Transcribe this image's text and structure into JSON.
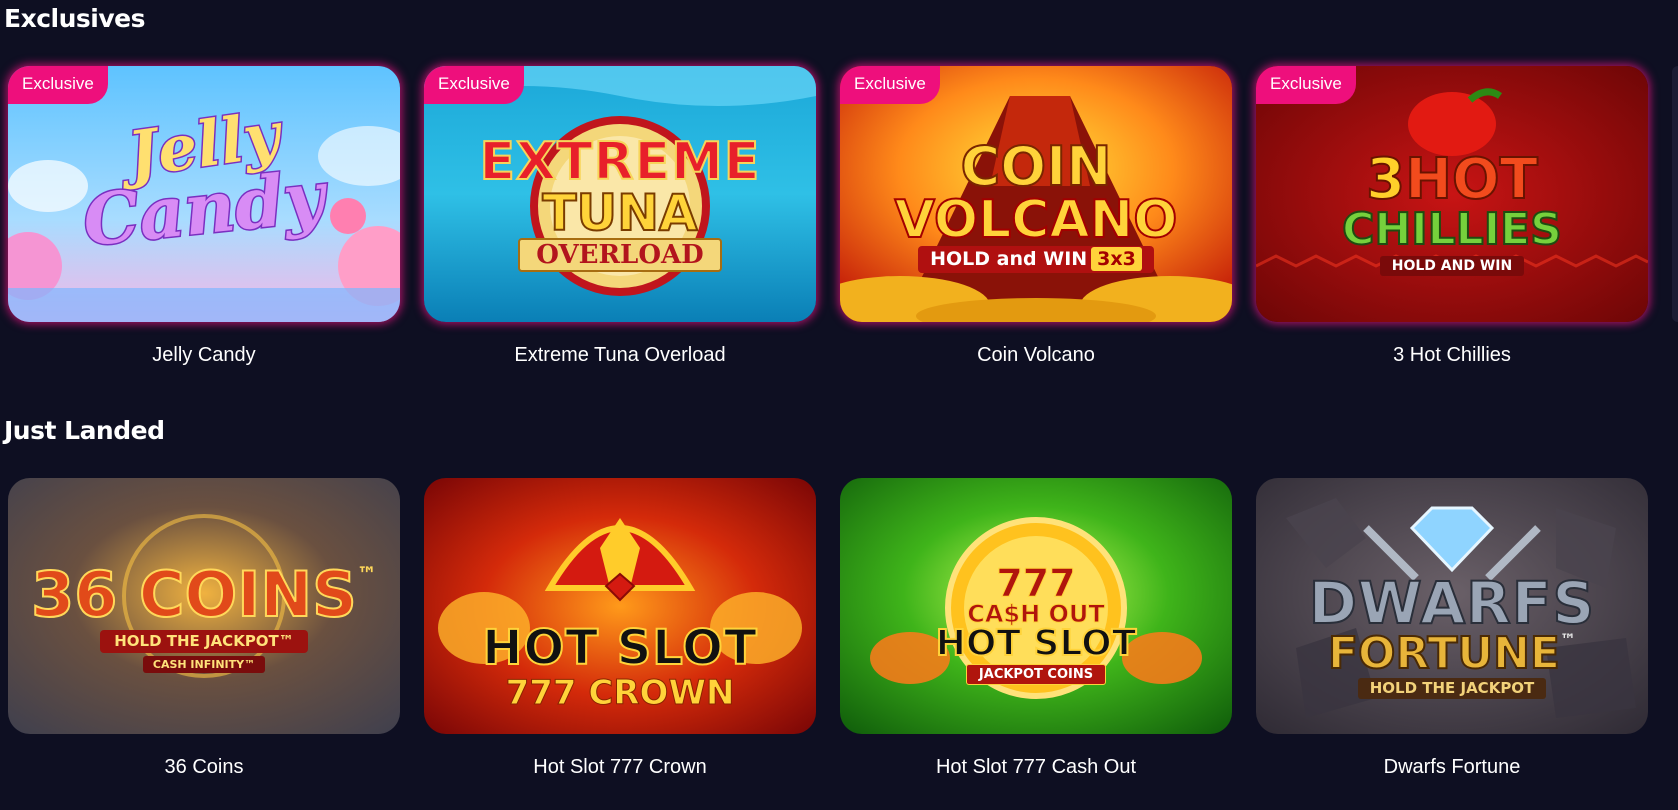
{
  "sections": [
    {
      "title": "Exclusives",
      "games": [
        {
          "name": "Jelly Candy",
          "badge": "Exclusive",
          "logo": [
            "Jelly",
            "Candy"
          ]
        },
        {
          "name": "Extreme Tuna Overload",
          "badge": "Exclusive",
          "logo": [
            "EXTREME",
            "TUNA",
            "OVERLOAD"
          ]
        },
        {
          "name": "Coin Volcano",
          "badge": "Exclusive",
          "logo": [
            "COIN",
            "VOLCANO",
            "HOLD and WIN",
            "3x3"
          ]
        },
        {
          "name": "3 Hot Chillies",
          "badge": "Exclusive",
          "logo": [
            "3",
            "HOT",
            "CHILLIES",
            "HOLD AND WIN"
          ]
        }
      ]
    },
    {
      "title": "Just Landed",
      "games": [
        {
          "name": "36 Coins",
          "logo": [
            "36 COINS",
            "™",
            "HOLD THE JACKPOT™",
            "CASH INFINITY™"
          ]
        },
        {
          "name": "Hot Slot 777 Crown",
          "logo": [
            "HOT SLOT",
            "777 CROWN"
          ]
        },
        {
          "name": "Hot Slot 777 Cash Out",
          "logo": [
            "777",
            "CA$H OUT",
            "HOT SLOT",
            "JACKPOT COINS"
          ]
        },
        {
          "name": "Dwarfs Fortune",
          "logo": [
            "DWARFS",
            "FORTUNE",
            "™",
            "HOLD THE JACKPOT"
          ]
        }
      ]
    }
  ],
  "colors": {
    "background": "#0e0f22",
    "badge": "#ee0f7c",
    "glow": "#ff148c"
  }
}
